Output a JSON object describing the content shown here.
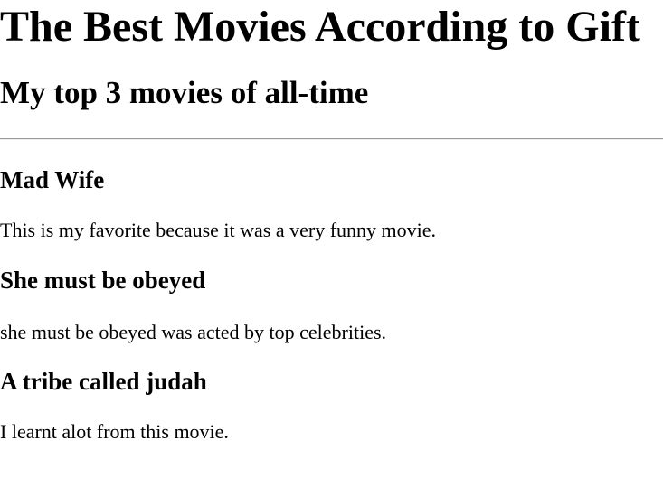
{
  "page": {
    "title": "The Best Movies According to Gift",
    "subtitle": "My top 3 movies of all-time"
  },
  "movies": [
    {
      "title": "Mad Wife",
      "description": "This is my favorite because it was a very funny movie."
    },
    {
      "title": "She must be obeyed",
      "description": "she must be obeyed was acted by top celebrities."
    },
    {
      "title": "A tribe called judah",
      "description": "I learnt alot from this movie."
    }
  ]
}
